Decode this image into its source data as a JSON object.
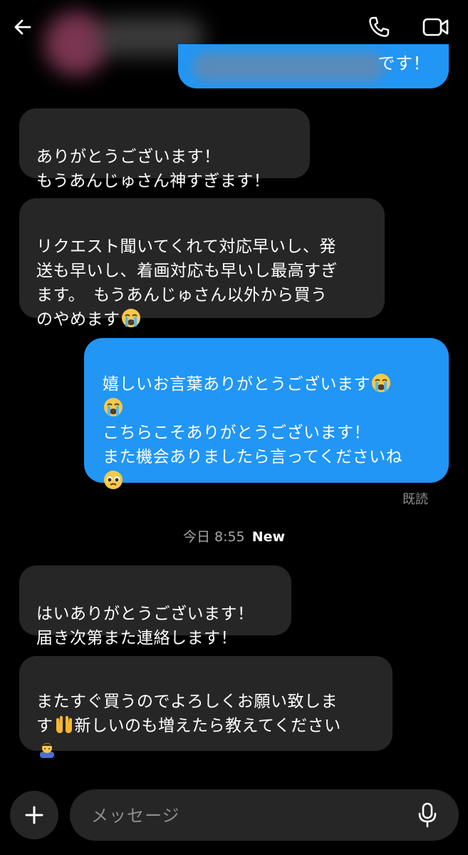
{
  "header": {
    "back_icon": "arrow-left-icon",
    "call_icon": "phone-icon",
    "video_icon": "video-camera-icon"
  },
  "messages": {
    "partial_outgoing": "です！",
    "msg1": "ありがとうございます！\nもうあんじゅさん神すぎます！",
    "msg2": "リクエスト聞いてくれて対応早いし、発\n送も早いし、着画対応も早いし最高すぎ\nます。　もうあんじゅさん以外から買う\nのやめます",
    "msg3_line1": "嬉しいお言葉ありがとうございます",
    "msg3_rest": "こちらこそありがとうございます！\nまた機会ありましたら言ってくださいね",
    "msg4": "はいありがとうございます！\n届き次第また連絡します！",
    "msg5_line1": "またすぐ買うのでよろしくお願い致しま",
    "msg5_line2a": "す",
    "msg5_line2b": "新しいのも増えたら教えてください"
  },
  "status": {
    "seen": "既読",
    "time": "今日 8:55",
    "new": "New"
  },
  "composer": {
    "placeholder": "メッセージ",
    "plus_icon": "plus-icon",
    "mic_icon": "microphone-icon"
  },
  "emojis": {
    "crying": "loudly-crying-face-emoji",
    "pleading": "pleading-face-emoji",
    "raised_hands": "palms-up-together-emoji",
    "bowing": "bowing-person-emoji"
  },
  "colors": {
    "background": "#000000",
    "incoming_bubble": "#262626",
    "outgoing_bubble": "#2196f5",
    "secondary_text": "#8e8e8e"
  }
}
